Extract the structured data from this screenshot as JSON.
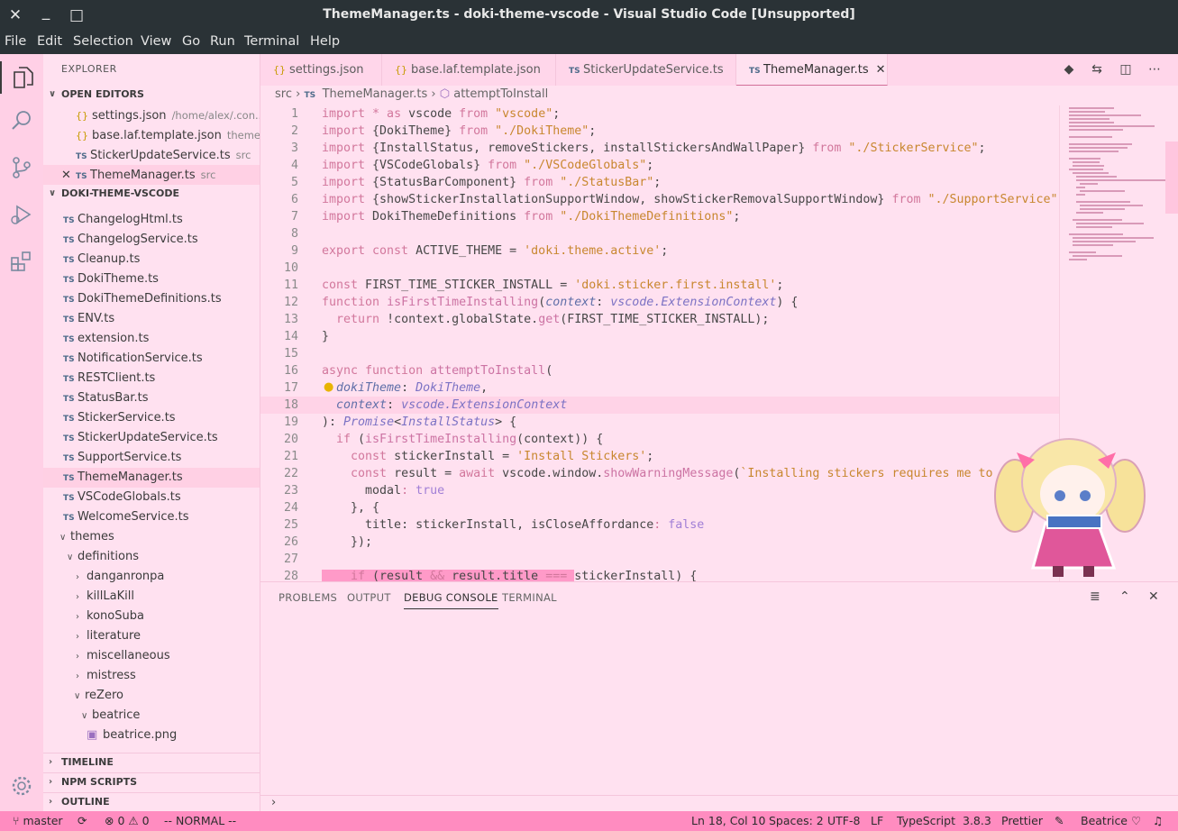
{
  "titlebar": {
    "title": "ThemeManager.ts - doki-theme-vscode - Visual Studio Code [Unsupported]",
    "close_glyph": "✕",
    "max_glyph": "□",
    "min_glyph": "_"
  },
  "menu": [
    "File",
    "Edit",
    "Selection",
    "View",
    "Go",
    "Run",
    "Terminal",
    "Help"
  ],
  "sidebar": {
    "title": "EXPLORER",
    "open_editors_header": "OPEN EDITORS",
    "open_editors": [
      {
        "badge": "{}",
        "name": "settings.json",
        "desc": "/home/alex/.con..."
      },
      {
        "badge": "{}",
        "name": "base.laf.template.json",
        "desc": "theme..."
      },
      {
        "badge": "TS",
        "name": "StickerUpdateService.ts",
        "desc": "src"
      },
      {
        "badge": "TS",
        "name": "ThemeManager.ts",
        "desc": "src",
        "close": "✕"
      }
    ],
    "project_header": "DOKI-THEME-VSCODE",
    "files": [
      "ChangelogHtml.ts",
      "ChangelogService.ts",
      "Cleanup.ts",
      "DokiTheme.ts",
      "DokiThemeDefinitions.ts",
      "ENV.ts",
      "extension.ts",
      "NotificationService.ts",
      "RESTClient.ts",
      "StatusBar.ts",
      "StickerService.ts",
      "StickerUpdateService.ts",
      "SupportService.ts",
      "ThemeManager.ts",
      "VSCodeGlobals.ts",
      "WelcomeService.ts"
    ],
    "ts_badge": "TS",
    "themes_folder": "themes",
    "definitions_folder": "definitions",
    "subfolders": [
      "danganronpa",
      "killLaKill",
      "konoSuba",
      "literature",
      "miscellaneous",
      "mistress"
    ],
    "rezero_folder": "reZero",
    "beatrice_folder": "beatrice",
    "beatrice_file": "beatrice.png",
    "timeline": "TIMELINE",
    "npm_scripts": "NPM SCRIPTS",
    "outline": "OUTLINE"
  },
  "tabs": [
    {
      "badge": "{}",
      "label": "settings.json"
    },
    {
      "badge": "{}",
      "label": "base.laf.template.json"
    },
    {
      "badge": "TS",
      "label": "StickerUpdateService.ts"
    },
    {
      "badge": "TS",
      "label": "ThemeManager.ts",
      "close": "✕"
    }
  ],
  "breadcrumb": {
    "folder": "src",
    "sep": "›",
    "badge": "TS",
    "file": "ThemeManager.ts",
    "symbol": "attemptToInstall"
  },
  "code": {
    "line_numbers": [
      "1",
      "2",
      "3",
      "4",
      "5",
      "6",
      "7",
      "8",
      "9",
      "10",
      "11",
      "12",
      "13",
      "14",
      "15",
      "16",
      "17",
      "18",
      "19",
      "20",
      "21",
      "22",
      "23",
      "24",
      "25",
      "26",
      "27",
      "28"
    ],
    "l1": {
      "a": "import ",
      "b": "* as ",
      "c": "vscode ",
      "d": "from ",
      "e": "\"vscode\"",
      "f": ";"
    },
    "l2": {
      "a": "import ",
      "b": "{DokiTheme} ",
      "c": "from ",
      "d": "\"./DokiTheme\"",
      "e": ";"
    },
    "l3": {
      "a": "import ",
      "b": "{InstallStatus, removeStickers, installStickersAndWallPaper} ",
      "c": "from ",
      "d": "\"./StickerService\"",
      "e": ";"
    },
    "l4": {
      "a": "import ",
      "b": "{VSCodeGlobals} ",
      "c": "from ",
      "d": "\"./VSCodeGlobals\"",
      "e": ";"
    },
    "l5": {
      "a": "import ",
      "b": "{StatusBarComponent} ",
      "c": "from ",
      "d": "\"./StatusBar\"",
      "e": ";"
    },
    "l6": {
      "a": "import ",
      "b": "{showStickerInstallationSupportWindow, showStickerRemovalSupportWindow} ",
      "c": "from ",
      "d": "\"./SupportService\"",
      "e": ";"
    },
    "l7": {
      "a": "import ",
      "b": "DokiThemeDefinitions ",
      "c": "from ",
      "d": "\"./DokiThemeDefinitions\"",
      "e": ";"
    },
    "l9": {
      "a": "export const ",
      "b": "ACTIVE_THEME = ",
      "c": "'doki.theme.active'",
      "d": ";"
    },
    "l11": {
      "a": "const ",
      "b": "FIRST_TIME_STICKER_INSTALL = ",
      "c": "'doki.sticker.first.install'",
      "d": ";"
    },
    "l12": {
      "a": "function ",
      "b": "isFirstTimeInstalling",
      "c": "(",
      "d": "context",
      "e": ": ",
      "f": "vscode",
      "g": ".",
      "h": "ExtensionContext",
      "i": ") {"
    },
    "l13": {
      "a": "  return ",
      "b": "!context.globalState.",
      "c": "get",
      "d": "(FIRST_TIME_STICKER_INSTALL);"
    },
    "l14": {
      "a": "}"
    },
    "l16": {
      "a": "async function ",
      "b": "attemptToInstall",
      "c": "("
    },
    "l17": {
      "a": "  ",
      "b": "dokiTheme",
      "c": ": ",
      "d": "DokiTheme",
      "e": ","
    },
    "l18": {
      "a": "  ",
      "b": "context",
      "c": ": ",
      "d": "vscode",
      "e": ".",
      "f": "ExtensionContext"
    },
    "l19": {
      "a": "): ",
      "b": "Promise",
      "c": "<",
      "d": "InstallStatus",
      "e": "> {"
    },
    "l20": {
      "a": "  if ",
      "b": "(",
      "c": "isFirstTimeInstalling",
      "d": "(context)) {"
    },
    "l21": {
      "a": "    const ",
      "b": "stickerInstall = ",
      "c": "'Install Stickers'",
      "d": ";"
    },
    "l22": {
      "a": "    const ",
      "b": "result = ",
      "c": "await ",
      "d": "vscode.window.",
      "e": "showWarningMessage",
      "f": "(",
      "g": "`Installing stickers requires me to corr"
    },
    "l23": {
      "a": "      modal",
      "b": ": ",
      "c": "true"
    },
    "l24": {
      "a": "    }, {"
    },
    "l25": {
      "a": "      title",
      "b": ": stickerInstall, ",
      "c": "isCloseAffordance",
      "d": ": ",
      "e": "false"
    },
    "l26": {
      "a": "    });"
    },
    "l28": {
      "a": "    if ",
      "b": "(result ",
      "c": "&& ",
      "d": "result.title ",
      "e": "=== ",
      "f": "stickerInstall) {"
    }
  },
  "panel": {
    "tabs": [
      "PROBLEMS",
      "OUTPUT",
      "DEBUG CONSOLE",
      "TERMINAL"
    ],
    "prompt": "›"
  },
  "statusbar": {
    "branch": "master",
    "sync": "⟳",
    "errors": "⊗ 0",
    "warnings": "⚠ 0",
    "mode": "-- NORMAL --",
    "position": "Ln 18, Col 10",
    "spaces": "Spaces: 2",
    "encoding": "UTF-8",
    "eol": "LF",
    "language": "TypeScript",
    "version": "3.8.3",
    "formatter": "Prettier",
    "theme": "Beatrice ♡",
    "bell": "🔔"
  },
  "colors": {
    "background": "#ffe1f0",
    "titlebar": "#2a3236",
    "statusbar": "#ff8cc0",
    "keyword": "#d2779c",
    "string": "#c8872f",
    "type": "#7c72c4"
  }
}
